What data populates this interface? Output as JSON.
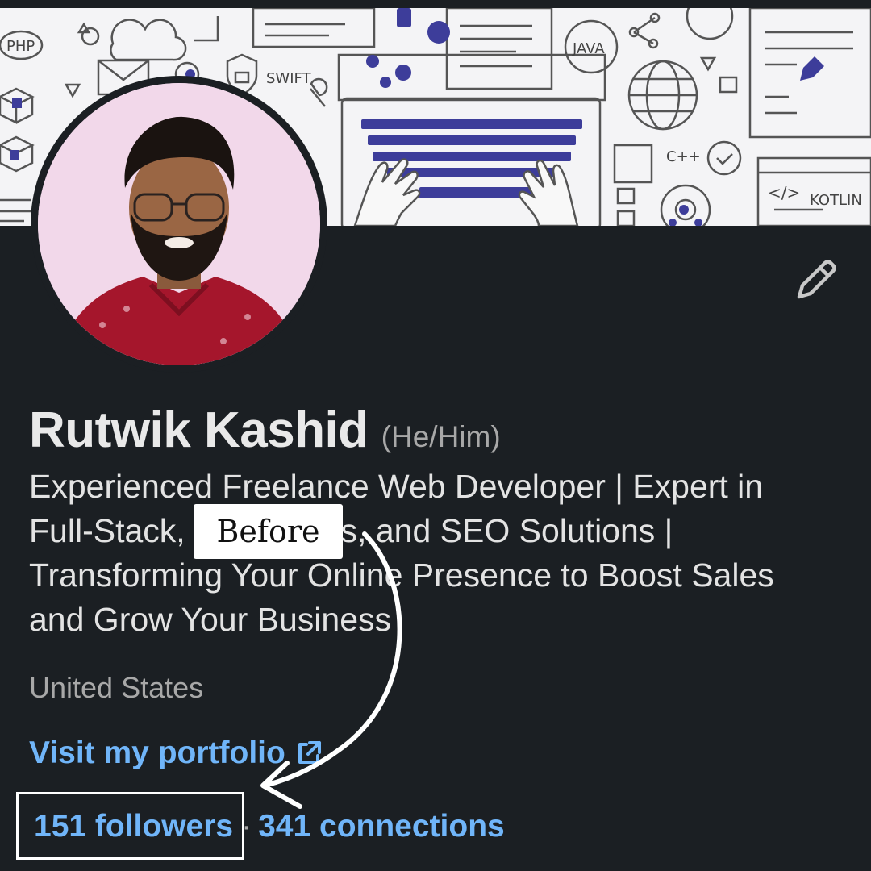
{
  "profile": {
    "name": "Rutwik Kashid",
    "pronouns": "(He/Him)",
    "headline": "Experienced Freelance Web Developer | Expert in Full-Stack, WordPress, and SEO Solutions | Transforming Your Online Presence to Boost Sales and Grow Your Business",
    "location": "United States",
    "portfolio_link": "Visit my portfolio",
    "followers": "151 followers",
    "separator": "·",
    "connections": "341 connections"
  },
  "banner": {
    "labels": [
      "PHP",
      "SWIFT",
      "JAVA",
      "C++",
      "KOTLIN",
      "</>"
    ]
  },
  "annotation": {
    "label": "Before"
  },
  "colors": {
    "background": "#1b1f23",
    "link": "#70b5f9",
    "banner_accent": "#3d3d9a",
    "avatar_bg": "#f2d8ea"
  },
  "icons": {
    "edit": "pencil-icon",
    "external": "external-link-icon"
  }
}
